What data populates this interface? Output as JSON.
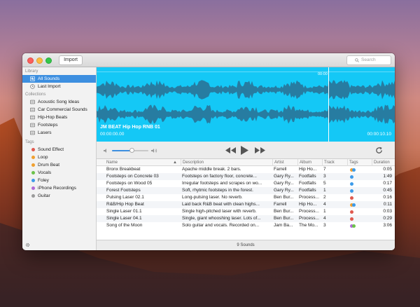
{
  "toolbar": {
    "import_label": "Import",
    "search_placeholder": "Search"
  },
  "sidebar": {
    "library_heading": "Library",
    "library": [
      {
        "label": "All Sounds",
        "icon": "waveform-icon",
        "selected": true
      },
      {
        "label": "Last Import",
        "icon": "clock-icon",
        "selected": false
      }
    ],
    "collections_heading": "Collections",
    "collections": [
      {
        "label": "Acoustic Song Ideas"
      },
      {
        "label": "Car Commercial Sounds"
      },
      {
        "label": "Hip-Hop Beats"
      },
      {
        "label": "Footsteps"
      },
      {
        "label": "Lasers"
      }
    ],
    "tags_heading": "Tags",
    "tags": [
      {
        "label": "Sound Effect",
        "color": "#e05a4f"
      },
      {
        "label": "Loop",
        "color": "#f0a030"
      },
      {
        "label": "Drum Beat",
        "color": "#f0a030"
      },
      {
        "label": "Vocals",
        "color": "#6cc24a"
      },
      {
        "label": "Foley",
        "color": "#3d9be9"
      },
      {
        "label": "iPhone Recordings",
        "color": "#b06ad6"
      },
      {
        "label": "Guitar",
        "color": "#9a9a9a"
      }
    ]
  },
  "waveform": {
    "title": "JM BEAT Hip Hop RNB 01",
    "start_time": "00:00:00.00",
    "end_time": "00:00:10.10",
    "marker_time": "00:00",
    "color": "#14c8f6"
  },
  "table": {
    "headers": [
      "Name",
      "Description",
      "Artist",
      "Album",
      "Track",
      "Tags",
      "Duration"
    ],
    "rows": [
      {
        "name": "Bronx Breakbeat",
        "description": "Apache middle break. 2 bars.",
        "artist": "Farrell",
        "album": "Hip Ho...",
        "track": "7",
        "tags": [
          "#f0a030",
          "#3d9be9"
        ],
        "duration": "0:05"
      },
      {
        "name": "Footsteps on Concrete 03",
        "description": "Footsteps on factory floor, concrete...",
        "artist": "Gary Ry...",
        "album": "Footfalls",
        "track": "3",
        "tags": [
          "#3d9be9"
        ],
        "duration": "1:49"
      },
      {
        "name": "Footsteps on Wood 05",
        "description": "Irregular footsteps and scrapes on wo...",
        "artist": "Gary Ry...",
        "album": "Footfalls",
        "track": "5",
        "tags": [
          "#3d9be9"
        ],
        "duration": "0:17"
      },
      {
        "name": "Forest Footsteps",
        "description": "Soft, rhytmic footsteps in the forest.",
        "artist": "Gary Ry...",
        "album": "Footfalls",
        "track": "1",
        "tags": [
          "#3d9be9"
        ],
        "duration": "0:45"
      },
      {
        "name": "Pulsing Laser 02.1",
        "description": "Long-pulsing laser. No reverb.",
        "artist": "Ben Bur...",
        "album": "Process...",
        "track": "2",
        "tags": [
          "#e05a4f"
        ],
        "duration": "0:16"
      },
      {
        "name": "R&B/Hip Hop Beat",
        "description": "Laid back R&B beat with clean highs...",
        "artist": "Farrell",
        "album": "Hip Ho...",
        "track": "4",
        "tags": [
          "#f0a030",
          "#3d9be9"
        ],
        "duration": "0:11"
      },
      {
        "name": "Single Laser 01.1",
        "description": "Single high-pitched laser with reverb.",
        "artist": "Ben Bur...",
        "album": "Process...",
        "track": "1",
        "tags": [
          "#e05a4f"
        ],
        "duration": "0:03"
      },
      {
        "name": "Single Laser 04.1",
        "description": "Single, giant whooshing laser. Lots of...",
        "artist": "Ben Bur...",
        "album": "Process...",
        "track": "4",
        "tags": [
          "#e05a4f"
        ],
        "duration": "0:29"
      },
      {
        "name": "Song of the Moon",
        "description": "Solo guitar and vocals. Recorded on...",
        "artist": "Jam Ba...",
        "album": "The Mo...",
        "track": "3",
        "tags": [
          "#b06ad6",
          "#6cc24a"
        ],
        "duration": "3:06"
      }
    ]
  },
  "transport": {
    "volume": 0.55
  },
  "status": {
    "count_label": "9 Sounds"
  }
}
